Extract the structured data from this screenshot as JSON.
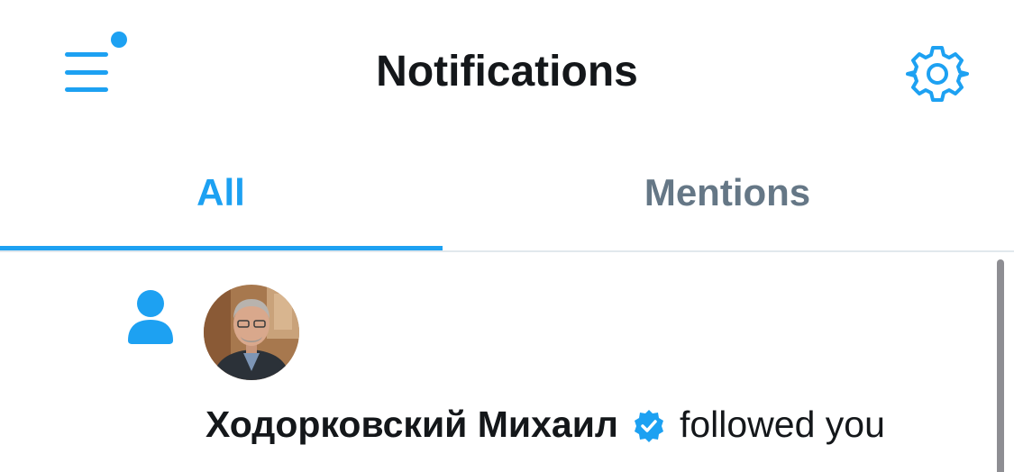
{
  "header": {
    "title": "Notifications",
    "menu_icon": "hamburger-menu-icon",
    "settings_icon": "gear-icon",
    "accent_color": "#1da1f2"
  },
  "tabs": [
    {
      "label": "All",
      "active": true
    },
    {
      "label": "Mentions",
      "active": false
    }
  ],
  "notifications": [
    {
      "type": "follow",
      "icon": "person-icon",
      "user_name": "Ходорковский Михаил",
      "verified": true,
      "action": "followed you"
    }
  ]
}
